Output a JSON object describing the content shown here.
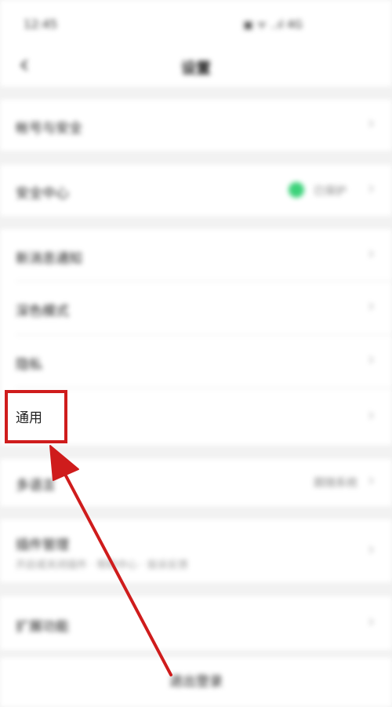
{
  "status_bar": {
    "time": "12:45",
    "icons": "▣ ᯤ ..ıl 4G"
  },
  "nav": {
    "title": "设置",
    "back": "‹"
  },
  "rows": {
    "account_security": "帐号与安全",
    "safety_center": "安全中心",
    "safety_status": "已保护",
    "message_notify": "新消息通知",
    "dark_mode": "深色模式",
    "privacy": "隐私",
    "general": "通用",
    "language": "多语言",
    "language_value": "跟随系统",
    "plugins": "插件管理",
    "plugins_sub": "开启或关闭插件 · 帮助中心 · 投诉反馈",
    "extensions": "扩展功能",
    "logout": "退出登录"
  },
  "chevron": "›",
  "colors": {
    "highlight": "#cf1c1c",
    "status_green": "#3cd27a"
  }
}
